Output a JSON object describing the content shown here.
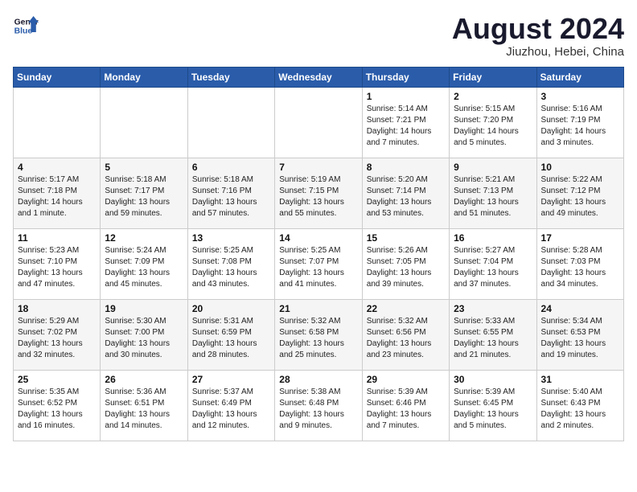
{
  "header": {
    "logo_line1": "General",
    "logo_line2": "Blue",
    "month": "August 2024",
    "location": "Jiuzhou, Hebei, China"
  },
  "days_of_week": [
    "Sunday",
    "Monday",
    "Tuesday",
    "Wednesday",
    "Thursday",
    "Friday",
    "Saturday"
  ],
  "weeks": [
    [
      {
        "day": "",
        "text": ""
      },
      {
        "day": "",
        "text": ""
      },
      {
        "day": "",
        "text": ""
      },
      {
        "day": "",
        "text": ""
      },
      {
        "day": "1",
        "text": "Sunrise: 5:14 AM\nSunset: 7:21 PM\nDaylight: 14 hours\nand 7 minutes."
      },
      {
        "day": "2",
        "text": "Sunrise: 5:15 AM\nSunset: 7:20 PM\nDaylight: 14 hours\nand 5 minutes."
      },
      {
        "day": "3",
        "text": "Sunrise: 5:16 AM\nSunset: 7:19 PM\nDaylight: 14 hours\nand 3 minutes."
      }
    ],
    [
      {
        "day": "4",
        "text": "Sunrise: 5:17 AM\nSunset: 7:18 PM\nDaylight: 14 hours\nand 1 minute."
      },
      {
        "day": "5",
        "text": "Sunrise: 5:18 AM\nSunset: 7:17 PM\nDaylight: 13 hours\nand 59 minutes."
      },
      {
        "day": "6",
        "text": "Sunrise: 5:18 AM\nSunset: 7:16 PM\nDaylight: 13 hours\nand 57 minutes."
      },
      {
        "day": "7",
        "text": "Sunrise: 5:19 AM\nSunset: 7:15 PM\nDaylight: 13 hours\nand 55 minutes."
      },
      {
        "day": "8",
        "text": "Sunrise: 5:20 AM\nSunset: 7:14 PM\nDaylight: 13 hours\nand 53 minutes."
      },
      {
        "day": "9",
        "text": "Sunrise: 5:21 AM\nSunset: 7:13 PM\nDaylight: 13 hours\nand 51 minutes."
      },
      {
        "day": "10",
        "text": "Sunrise: 5:22 AM\nSunset: 7:12 PM\nDaylight: 13 hours\nand 49 minutes."
      }
    ],
    [
      {
        "day": "11",
        "text": "Sunrise: 5:23 AM\nSunset: 7:10 PM\nDaylight: 13 hours\nand 47 minutes."
      },
      {
        "day": "12",
        "text": "Sunrise: 5:24 AM\nSunset: 7:09 PM\nDaylight: 13 hours\nand 45 minutes."
      },
      {
        "day": "13",
        "text": "Sunrise: 5:25 AM\nSunset: 7:08 PM\nDaylight: 13 hours\nand 43 minutes."
      },
      {
        "day": "14",
        "text": "Sunrise: 5:25 AM\nSunset: 7:07 PM\nDaylight: 13 hours\nand 41 minutes."
      },
      {
        "day": "15",
        "text": "Sunrise: 5:26 AM\nSunset: 7:05 PM\nDaylight: 13 hours\nand 39 minutes."
      },
      {
        "day": "16",
        "text": "Sunrise: 5:27 AM\nSunset: 7:04 PM\nDaylight: 13 hours\nand 37 minutes."
      },
      {
        "day": "17",
        "text": "Sunrise: 5:28 AM\nSunset: 7:03 PM\nDaylight: 13 hours\nand 34 minutes."
      }
    ],
    [
      {
        "day": "18",
        "text": "Sunrise: 5:29 AM\nSunset: 7:02 PM\nDaylight: 13 hours\nand 32 minutes."
      },
      {
        "day": "19",
        "text": "Sunrise: 5:30 AM\nSunset: 7:00 PM\nDaylight: 13 hours\nand 30 minutes."
      },
      {
        "day": "20",
        "text": "Sunrise: 5:31 AM\nSunset: 6:59 PM\nDaylight: 13 hours\nand 28 minutes."
      },
      {
        "day": "21",
        "text": "Sunrise: 5:32 AM\nSunset: 6:58 PM\nDaylight: 13 hours\nand 25 minutes."
      },
      {
        "day": "22",
        "text": "Sunrise: 5:32 AM\nSunset: 6:56 PM\nDaylight: 13 hours\nand 23 minutes."
      },
      {
        "day": "23",
        "text": "Sunrise: 5:33 AM\nSunset: 6:55 PM\nDaylight: 13 hours\nand 21 minutes."
      },
      {
        "day": "24",
        "text": "Sunrise: 5:34 AM\nSunset: 6:53 PM\nDaylight: 13 hours\nand 19 minutes."
      }
    ],
    [
      {
        "day": "25",
        "text": "Sunrise: 5:35 AM\nSunset: 6:52 PM\nDaylight: 13 hours\nand 16 minutes."
      },
      {
        "day": "26",
        "text": "Sunrise: 5:36 AM\nSunset: 6:51 PM\nDaylight: 13 hours\nand 14 minutes."
      },
      {
        "day": "27",
        "text": "Sunrise: 5:37 AM\nSunset: 6:49 PM\nDaylight: 13 hours\nand 12 minutes."
      },
      {
        "day": "28",
        "text": "Sunrise: 5:38 AM\nSunset: 6:48 PM\nDaylight: 13 hours\nand 9 minutes."
      },
      {
        "day": "29",
        "text": "Sunrise: 5:39 AM\nSunset: 6:46 PM\nDaylight: 13 hours\nand 7 minutes."
      },
      {
        "day": "30",
        "text": "Sunrise: 5:39 AM\nSunset: 6:45 PM\nDaylight: 13 hours\nand 5 minutes."
      },
      {
        "day": "31",
        "text": "Sunrise: 5:40 AM\nSunset: 6:43 PM\nDaylight: 13 hours\nand 2 minutes."
      }
    ]
  ]
}
